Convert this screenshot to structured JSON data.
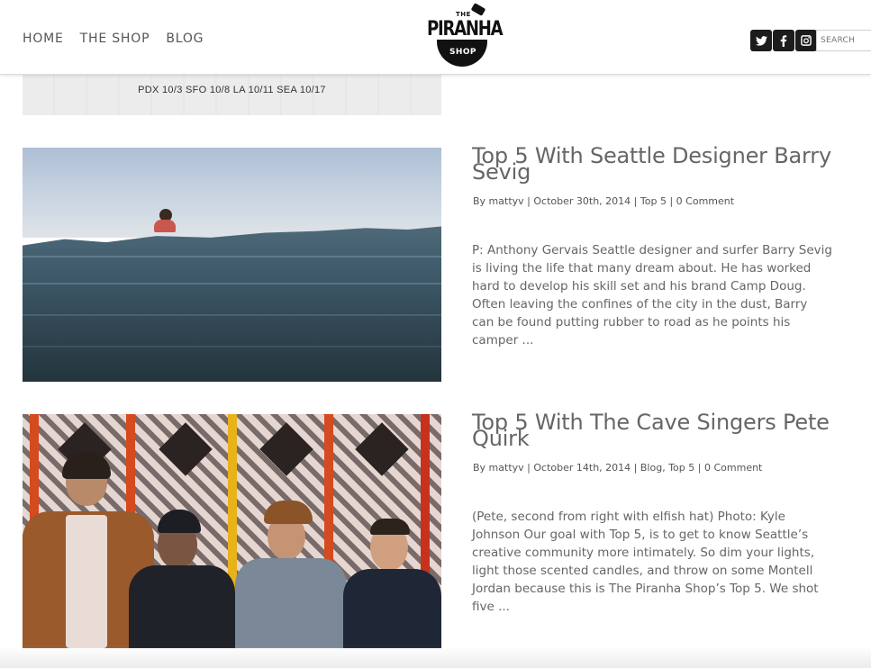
{
  "nav": {
    "items": [
      {
        "label": "HOME"
      },
      {
        "label": "THE SHOP"
      },
      {
        "label": "BLOG"
      }
    ]
  },
  "logo": {
    "small": "THE",
    "name": "PIRANHA",
    "sub": "SHOP"
  },
  "social": [
    {
      "icon": "twitter-icon",
      "glyph": "🐦"
    },
    {
      "icon": "facebook-icon",
      "glyph": "f"
    },
    {
      "icon": "instagram-icon",
      "glyph": "◙"
    }
  ],
  "search": {
    "placeholder": "SEARCH"
  },
  "banner": {
    "text": "PDX 10/3 SFO 10/8 LA 10/11 SEA 10/17"
  },
  "posts": [
    {
      "title": "Top 5 With Seattle Designer Barry Sevig",
      "meta_by": "By mattyv",
      "meta_date": "October 30th, 2014",
      "meta_categories": "Top 5",
      "meta_comments": "0 Comment",
      "excerpt": " P: Anthony Gervais Seattle designer and surfer Barry Sevig is living the life that many dream about. He has worked hard to develop his skill set and his brand Camp Doug. Often leaving the confines of the city in the dust, Barry can be found putting rubber to road as he points his camper ..."
    },
    {
      "title": "Top 5 With The Cave Singers Pete Quirk",
      "meta_by": "By mattyv",
      "meta_date": "October 14th, 2014",
      "meta_categories": "Blog, Top 5",
      "meta_comments": "0 Comment",
      "excerpt": "(Pete, second from right with elfish hat) Photo: Kyle Johnson Our goal with Top 5, is to get to know Seattle’s creative community more intimately. So dim your lights, light those scented candles, and throw on some Montell Jordan because this is The Piranha Shop’s Top 5. We shot five ..."
    }
  ],
  "meta_separator": "|"
}
